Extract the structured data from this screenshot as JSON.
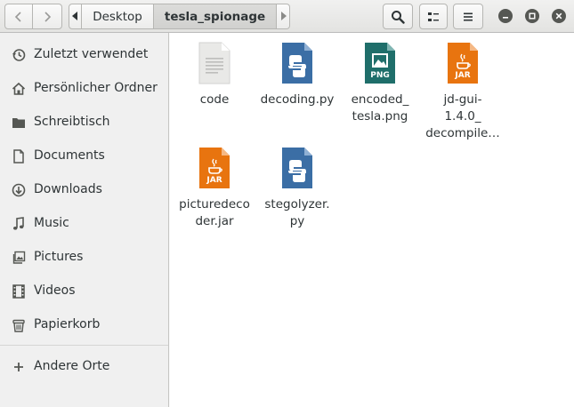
{
  "header": {
    "path": [
      "Desktop",
      "tesla_spionage"
    ],
    "icons": {
      "back": "go-previous-icon",
      "forward": "go-next-icon",
      "path_left": "pathbar-scroll-left-icon",
      "path_right": "pathbar-scroll-right-icon",
      "search": "search-icon",
      "view": "view-options-icon",
      "menu": "menu-icon",
      "minimize": "minimize-icon",
      "maximize": "maximize-icon",
      "close": "close-icon"
    }
  },
  "sidebar": {
    "items": [
      {
        "label": "Zuletzt verwendet",
        "icon": "recent-icon"
      },
      {
        "label": "Persönlicher Ordner",
        "icon": "home-icon"
      },
      {
        "label": "Schreibtisch",
        "icon": "desktop-folder-icon"
      },
      {
        "label": "Documents",
        "icon": "document-icon"
      },
      {
        "label": "Downloads",
        "icon": "download-icon"
      },
      {
        "label": "Music",
        "icon": "music-icon"
      },
      {
        "label": "Pictures",
        "icon": "pictures-icon"
      },
      {
        "label": "Videos",
        "icon": "video-icon"
      },
      {
        "label": "Papierkorb",
        "icon": "trash-icon"
      },
      {
        "label": "Andere Orte",
        "icon": "plus-icon"
      }
    ]
  },
  "files": [
    {
      "name": "code",
      "type": "text",
      "badge": ""
    },
    {
      "name": "decoding.py",
      "type": "python",
      "badge": ""
    },
    {
      "name": "encoded_\ntesla.png",
      "type": "png",
      "badge": "PNG"
    },
    {
      "name": "jd-gui-\n1.4.0_\ndecompile…",
      "type": "jar",
      "badge": "JAR"
    },
    {
      "name": "picturedeco\nder.jar",
      "type": "jar",
      "badge": "JAR"
    },
    {
      "name": "stegolyzer.\npy",
      "type": "python",
      "badge": ""
    }
  ],
  "colors": {
    "python_file": "#3b6ea5",
    "png_file": "#1f6e6a",
    "jar_file": "#e8740f",
    "text_file": "#e6e6e6"
  }
}
